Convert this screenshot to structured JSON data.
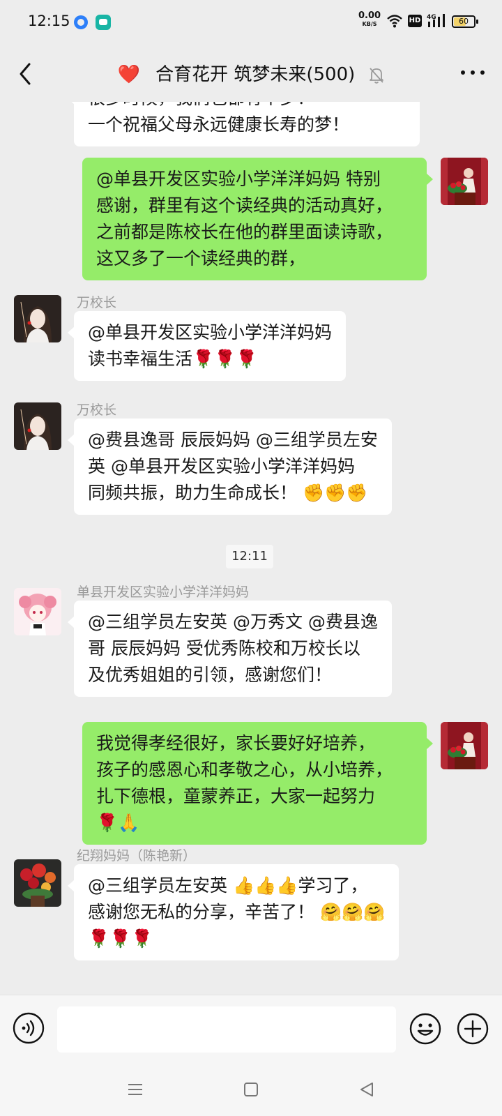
{
  "status_bar": {
    "time": "12:15",
    "net_speed": "0.00",
    "net_unit": "KB/S",
    "hd_badge": "HD",
    "signal_label": "4G",
    "battery": "60",
    "battery_level": 0.6
  },
  "header": {
    "title_emoji": "❤️",
    "title": "合育花开 筑梦未来(500)"
  },
  "messages": [
    {
      "direction": "in",
      "sender": "",
      "lines": [
        "很多时候，我们也都有个梦！",
        "一个祝福父母永远健康长寿的梦！"
      ]
    },
    {
      "direction": "out",
      "sender": "",
      "lines": [
        "@单县开发区实验小学洋洋妈妈  特别",
        "感谢，群里有这个读经典的活动真好，",
        "之前都是陈校长在他的群里面读诗歌，",
        "这又多了一个读经典的群，"
      ]
    },
    {
      "direction": "in",
      "sender": "万校长",
      "lines": [
        "@单县开发区实验小学洋洋妈妈",
        " 读书幸福生活🌹🌹🌹"
      ]
    },
    {
      "direction": "in",
      "sender": "万校长",
      "lines": [
        "@费县逸哥  辰辰妈妈  @三组学员左安",
        "英  @单县开发区实验小学洋洋妈妈",
        "同频共振，助力生命成长！ ✊✊✊"
      ]
    },
    {
      "direction": "in",
      "sender": "单县开发区实验小学洋洋妈妈",
      "lines": [
        "@三组学员左安英  @万秀文  @费县逸",
        "哥  辰辰妈妈  受优秀陈校和万校长以",
        "及优秀姐姐的引领，感谢您们！"
      ]
    },
    {
      "direction": "out",
      "sender": "",
      "lines": [
        "我觉得孝经很好，家长要好好培养，",
        "孩子的感恩心和孝敬之心，从小培养，",
        "扎下德根，童蒙养正，大家一起努力",
        "🌹🙏"
      ]
    },
    {
      "direction": "in",
      "sender": "纪翔妈妈（陈艳新）",
      "lines": [
        "@三组学员左安英 👍👍👍学习了，",
        "感谢您无私的分享，辛苦了！ 🤗🤗🤗",
        "🌹🌹🌹"
      ]
    }
  ],
  "time_divider": "12:11",
  "input": {
    "value": ""
  }
}
